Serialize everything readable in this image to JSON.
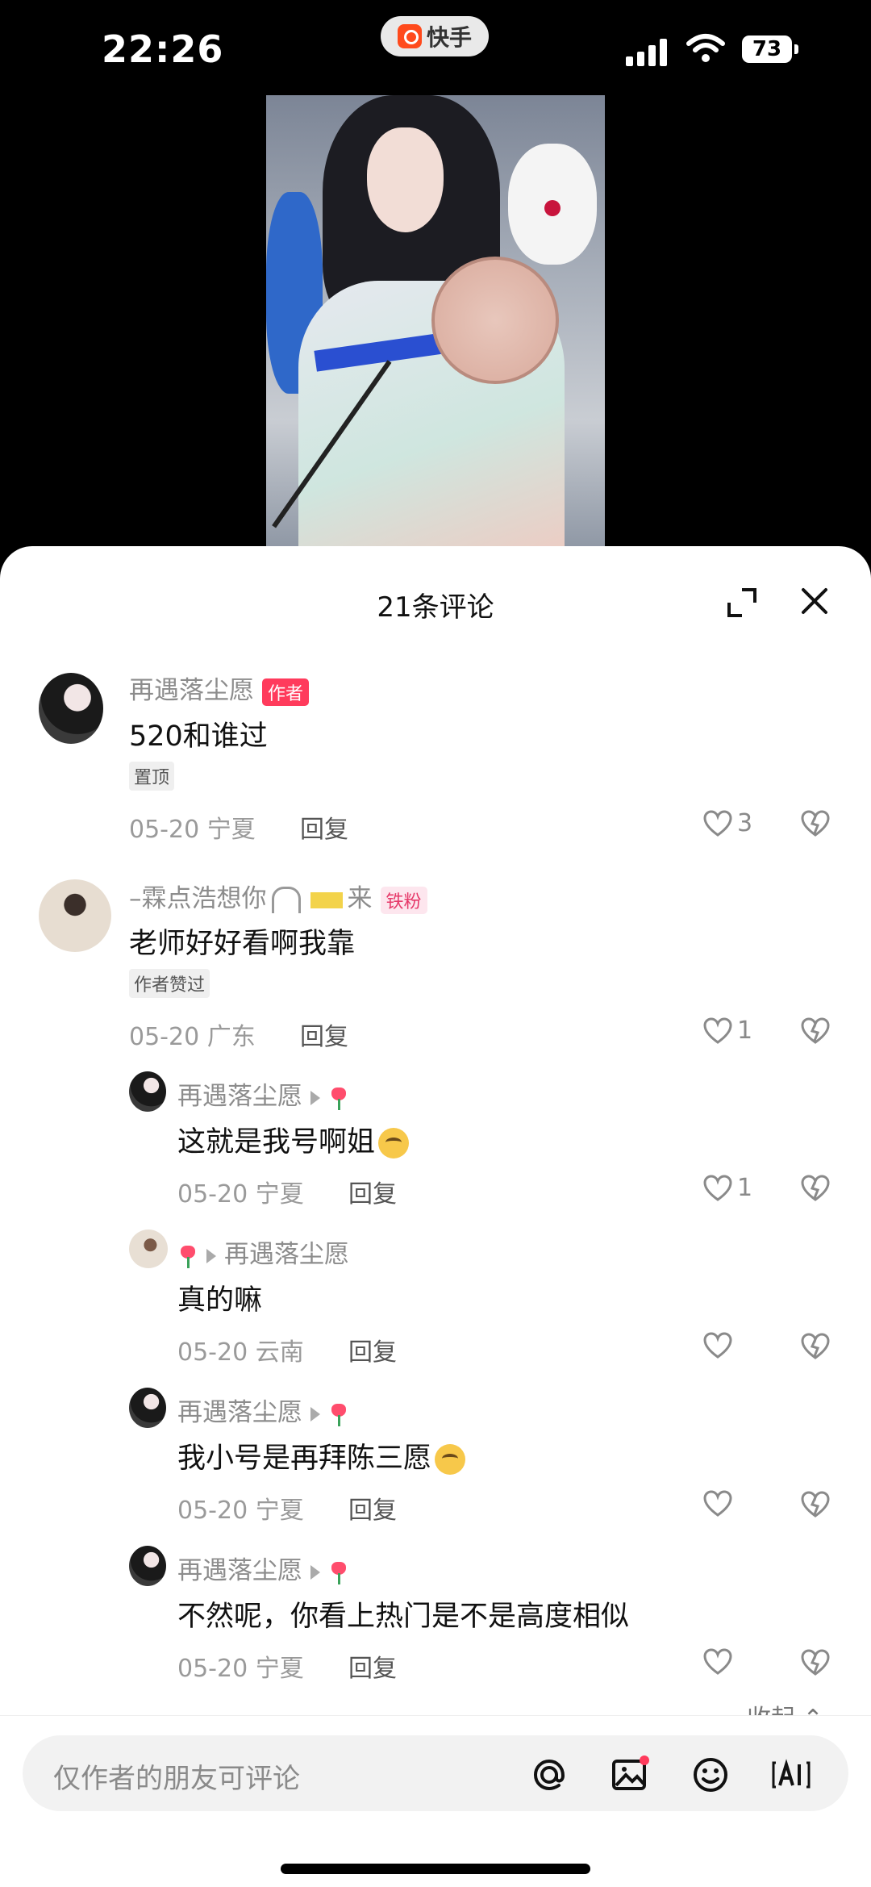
{
  "status_bar": {
    "time": "22:26",
    "app_pill": "快手",
    "battery": "73"
  },
  "sheet": {
    "title": "21条评论"
  },
  "comments": [
    {
      "username": "再遇落尘愿",
      "author_tag": "作者",
      "text": "520和谁过",
      "badge": "置顶",
      "date_location": "05-20 宁夏",
      "reply_label": "回复",
      "likes": "3"
    },
    {
      "username": "–霖点浩想你",
      "username_suffix": "来",
      "fan_tag": "铁粉",
      "text": "老师好好看啊我靠",
      "badge": "作者赞过",
      "date_location": "05-20 广东",
      "reply_label": "回复",
      "likes": "1"
    }
  ],
  "replies": [
    {
      "from": "再遇落尘愿",
      "text": "这就是我号啊姐",
      "date_location": "05-20 宁夏",
      "reply_label": "回复",
      "likes": "1"
    },
    {
      "to": "再遇落尘愿",
      "text": "真的嘛",
      "date_location": "05-20 云南",
      "reply_label": "回复",
      "likes": ""
    },
    {
      "from": "再遇落尘愿",
      "text": "我小号是再拜陈三愿",
      "date_location": "05-20 宁夏",
      "reply_label": "回复",
      "likes": ""
    },
    {
      "from": "再遇落尘愿",
      "text": "不然呢，你看上热门是不是高度相似",
      "date_location": "05-20 宁夏",
      "reply_label": "回复",
      "likes": ""
    }
  ],
  "collapse_label": "收起",
  "input": {
    "placeholder": "仅作者的朋友可评论"
  },
  "icons": [
    "at-icon",
    "image-icon",
    "emoji-icon",
    "ai-icon"
  ],
  "colors": {
    "author_tag": "#ff3b5c",
    "fan_tag": "#e63a6a",
    "tulip": "#ff4d6d"
  }
}
